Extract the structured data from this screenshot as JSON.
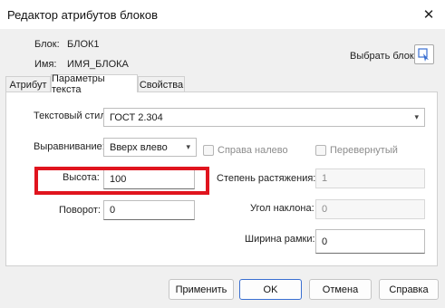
{
  "window": {
    "title": "Редактор атрибутов блоков"
  },
  "block": {
    "block_label": "Блок:",
    "block_value": "БЛОК1",
    "name_label": "Имя:",
    "name_value": "ИМЯ_БЛОКА",
    "pick_label": "Выбрать блок"
  },
  "tabs": [
    {
      "label": "Атрибут"
    },
    {
      "label": "Параметры текста",
      "active": true
    },
    {
      "label": "Свойства"
    }
  ],
  "text_params": {
    "style_label": "Текстовый стиль:",
    "style_value": "ГОСТ 2.304",
    "align_label": "Выравнивание:",
    "align_value": "Вверх влево",
    "rtl_label": "Справа налево",
    "upside_label": "Перевернутый",
    "height_label": "Высота:",
    "height_value": "100",
    "width_factor_label": "Степень растяжения:",
    "width_factor_value": "1",
    "rotation_label": "Поворот:",
    "rotation_value": "0",
    "oblique_label": "Угол наклона:",
    "oblique_value": "0",
    "frame_width_label": "Ширина рамки:",
    "frame_width_value": "0"
  },
  "buttons": {
    "apply": "Применить",
    "ok": "OK",
    "cancel": "Отмена",
    "help": "Справка"
  },
  "colors": {
    "highlight": "#e0141e",
    "default_button_border": "#3a6fd1"
  }
}
